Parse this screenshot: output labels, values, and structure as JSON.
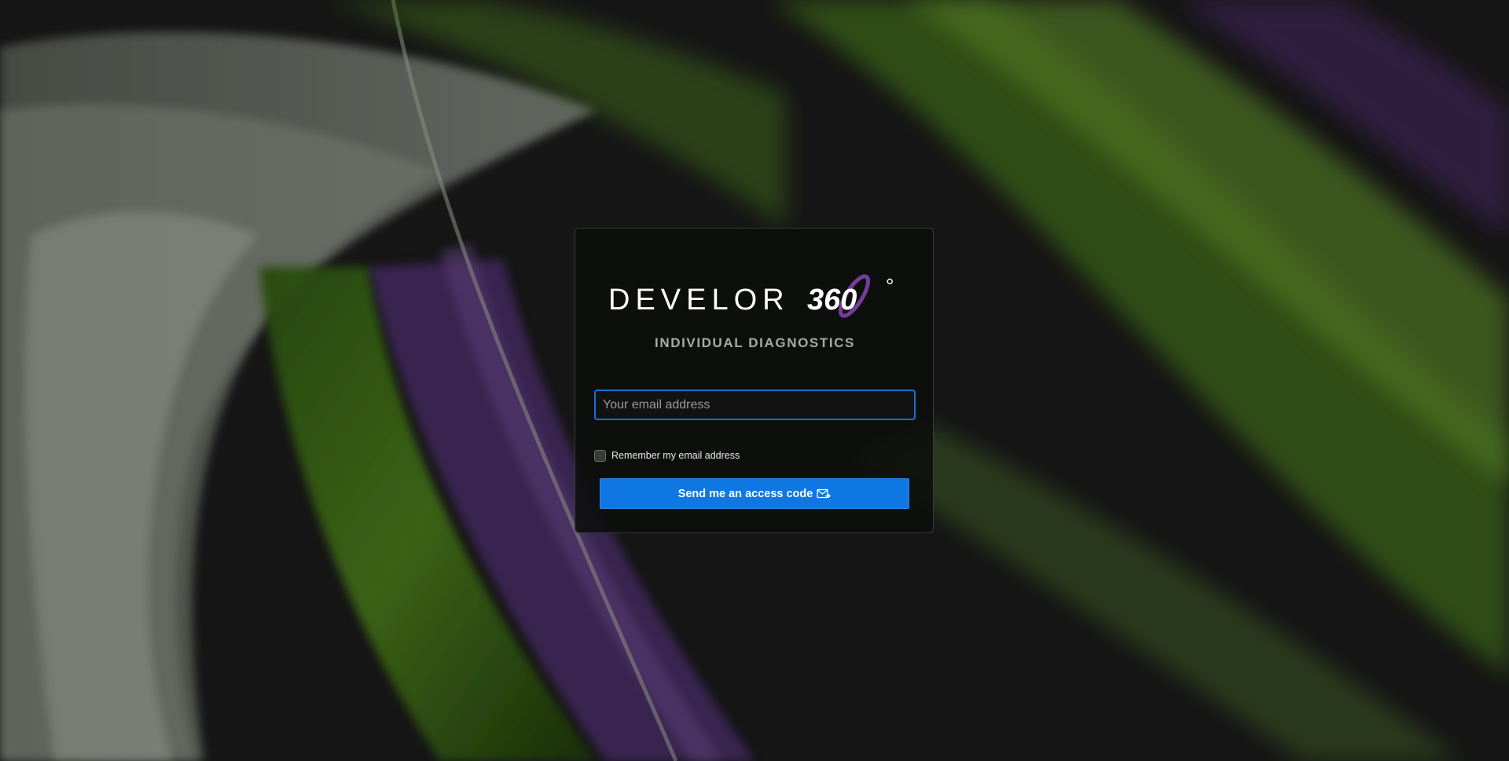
{
  "logo": {
    "wordmark": "DEVELOR",
    "number": "360",
    "degree": "°",
    "subtitle": "INDIVIDUAL DIAGNOSTICS"
  },
  "form": {
    "email_placeholder": "Your email address",
    "email_value": "",
    "remember_label": "Remember my email address",
    "remember_checked": false,
    "submit_label": "Send me an access code",
    "submit_icon": "mail-send-icon"
  },
  "colors": {
    "accent": "#0f77e2",
    "focus_border": "#1a6fd6",
    "logo_purple": "#7a3fa6",
    "bg_green": "#4f8a1e",
    "bg_purple": "#4a2d66"
  }
}
